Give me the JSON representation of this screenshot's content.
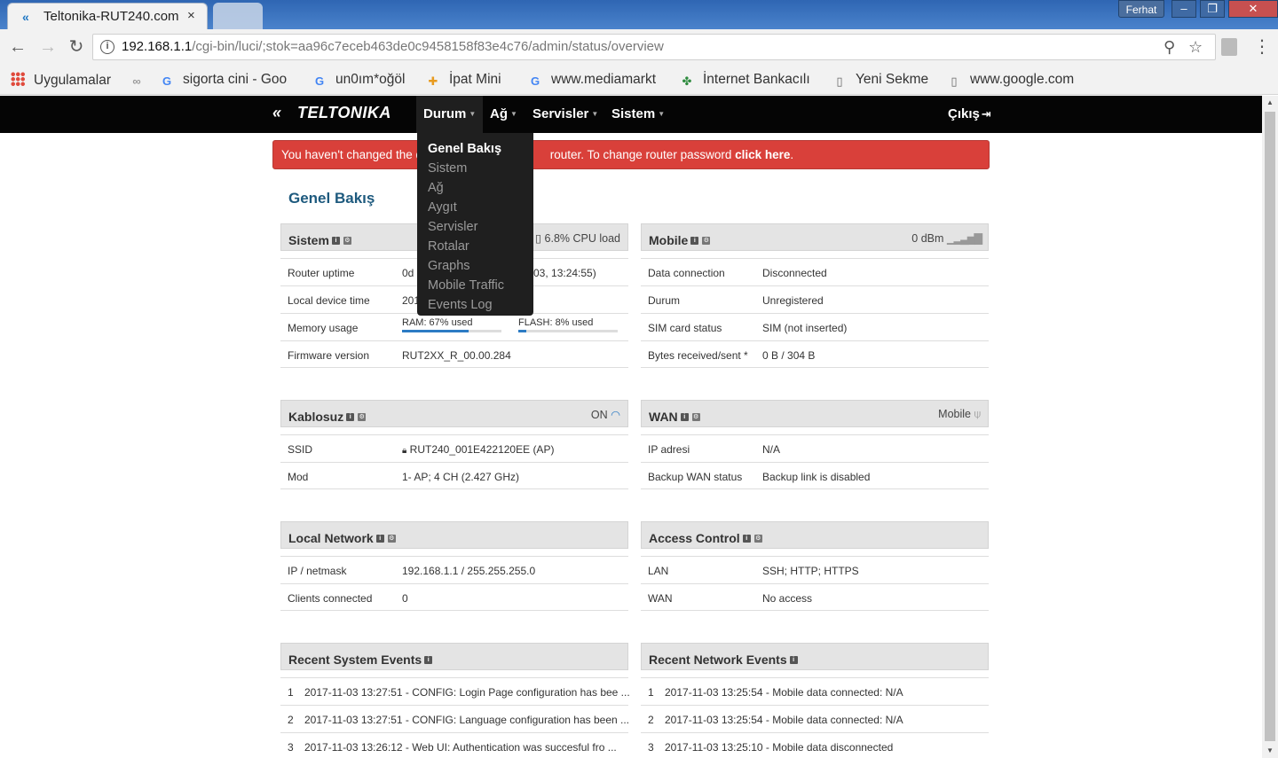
{
  "browser": {
    "tab_title": "Teltonika-RUT240.com",
    "tab_close": "×",
    "user": "Ferhat",
    "url_host": "192.168.1.1",
    "url_path": "/cgi-bin/luci/;stok=aa96c7eceb463de0c9458158f83e4c76/admin/status/overview",
    "bookmarks": [
      {
        "label": "Uygulamalar"
      },
      {
        "label": "sigorta cini - Goo"
      },
      {
        "label": "un0ım*oğöl"
      },
      {
        "label": "İpat Mini"
      },
      {
        "label": "www.mediamarkt"
      },
      {
        "label": "İnternet Bankacılı"
      },
      {
        "label": "Yeni Sekme"
      },
      {
        "label": "www.google.com"
      }
    ]
  },
  "nav": {
    "logo": "TELTONIKA",
    "items": [
      {
        "label": "Durum"
      },
      {
        "label": "Ağ"
      },
      {
        "label": "Servisler"
      },
      {
        "label": "Sistem"
      }
    ],
    "logout": "Çıkış"
  },
  "dropdown": {
    "items": [
      {
        "label": "Genel Bakış"
      },
      {
        "label": "Sistem"
      },
      {
        "label": "Ağ"
      },
      {
        "label": "Aygıt"
      },
      {
        "label": "Servisler"
      },
      {
        "label": "Rotalar"
      },
      {
        "label": "Graphs"
      },
      {
        "label": "Mobile Traffic"
      },
      {
        "label": "Events Log"
      }
    ]
  },
  "alert": {
    "text_start": "You haven't changed the d",
    "text_mid": " router. To change router password ",
    "link": "click here",
    "text_end": "."
  },
  "page_title": "Genel Bakış",
  "system": {
    "title": "Sistem",
    "cpu": "6.8% CPU load",
    "rows": {
      "uptime_k": "Router uptime",
      "uptime_v": "0d",
      "uptime_tail": "03, 13:24:55)",
      "time_k": "Local device time",
      "time_v": "201",
      "mem_k": "Memory usage",
      "ram_label": "RAM: 67% used",
      "ram_pct": 67,
      "flash_label": "FLASH: 8% used",
      "flash_pct": 8,
      "fw_k": "Firmware version",
      "fw_v": "RUT2XX_R_00.00.284"
    }
  },
  "mobile": {
    "title": "Mobile",
    "signal": "0 dBm",
    "rows": [
      {
        "k": "Data connection",
        "v": "Disconnected"
      },
      {
        "k": "Durum",
        "v": "Unregistered"
      },
      {
        "k": "SIM card status",
        "v": "SIM (not inserted)"
      },
      {
        "k": "Bytes received/sent *",
        "v": "0 B / 304 B"
      }
    ]
  },
  "wireless": {
    "title": "Kablosuz",
    "state": "ON",
    "rows": [
      {
        "k": "SSID",
        "v": "RUT240_001E422120EE (AP)"
      },
      {
        "k": "Mod",
        "v": "1- AP; 4 CH (2.427 GHz)"
      }
    ]
  },
  "wan": {
    "title": "WAN",
    "state": "Mobile",
    "rows": [
      {
        "k": "IP adresi",
        "v": "N/A"
      },
      {
        "k": "Backup WAN status",
        "v": "Backup link is disabled"
      }
    ]
  },
  "local": {
    "title": "Local Network",
    "rows": [
      {
        "k": "IP / netmask",
        "v": "192.168.1.1 / 255.255.255.0"
      },
      {
        "k": "Clients connected",
        "v": "0"
      }
    ]
  },
  "access": {
    "title": "Access Control",
    "rows": [
      {
        "k": "LAN",
        "v": "SSH; HTTP; HTTPS"
      },
      {
        "k": "WAN",
        "v": "No access"
      }
    ]
  },
  "sys_events": {
    "title": "Recent System Events",
    "rows": [
      {
        "n": "1",
        "t": "2017-11-03 13:27:51 - CONFIG: Login Page configuration has bee ..."
      },
      {
        "n": "2",
        "t": "2017-11-03 13:27:51 - CONFIG: Language configuration has been ..."
      },
      {
        "n": "3",
        "t": "2017-11-03 13:26:12 - Web UI: Authentication was succesful fro ..."
      }
    ]
  },
  "net_events": {
    "title": "Recent Network Events",
    "rows": [
      {
        "n": "1",
        "t": "2017-11-03 13:25:54 - Mobile data connected: N/A"
      },
      {
        "n": "2",
        "t": "2017-11-03 13:25:54 - Mobile data connected: N/A"
      },
      {
        "n": "3",
        "t": "2017-11-03 13:25:10 - Mobile data disconnected"
      }
    ]
  }
}
